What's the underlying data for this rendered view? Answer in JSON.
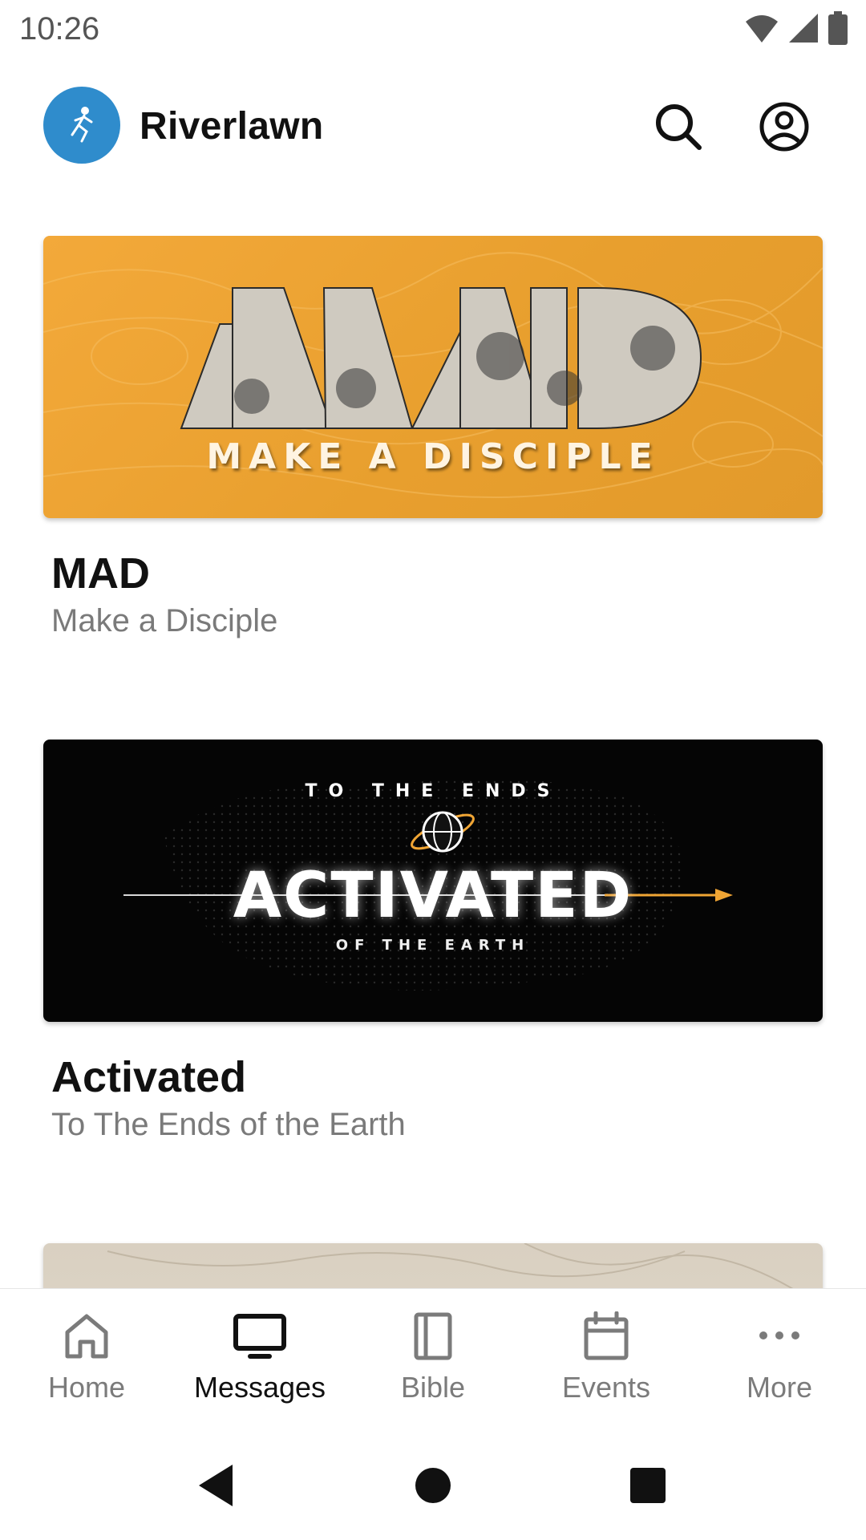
{
  "status": {
    "time": "10:26"
  },
  "app": {
    "title": "Riverlawn"
  },
  "series": [
    {
      "title": "MAD",
      "subtitle": "Make a Disciple",
      "banner_text": "MAKE A DISCIPLE",
      "banner_logo": "MAD"
    },
    {
      "title": "Activated",
      "subtitle": "To The Ends of the Earth",
      "banner_top": "TO THE ENDS",
      "banner_main": "ACTIVATED",
      "banner_bottom": "OF THE EARTH"
    }
  ],
  "nav": [
    {
      "label": "Home",
      "icon": "home-icon"
    },
    {
      "label": "Messages",
      "icon": "tv-icon",
      "active": true
    },
    {
      "label": "Bible",
      "icon": "book-icon"
    },
    {
      "label": "Events",
      "icon": "calendar-icon"
    },
    {
      "label": "More",
      "icon": "more-icon"
    }
  ],
  "colors": {
    "accent": "#2f8ccc",
    "mad_orange": "#f0a534",
    "activated_arrow": "#f0a534"
  }
}
